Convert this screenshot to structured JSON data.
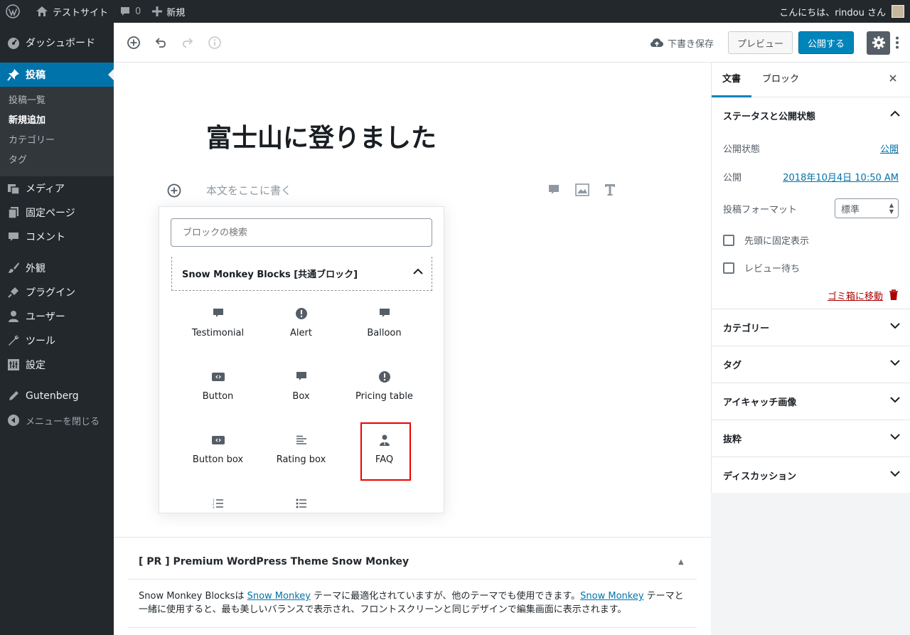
{
  "adminbar": {
    "site_name": "テストサイト",
    "comments_count": "0",
    "new_label": "新規",
    "greeting": "こんにちは、rindou さん"
  },
  "sidebar": {
    "dashboard": "ダッシュボード",
    "posts": "投稿",
    "posts_sub": [
      "投稿一覧",
      "新規追加",
      "カテゴリー",
      "タグ"
    ],
    "media": "メディア",
    "pages": "固定ページ",
    "comments": "コメント",
    "appearance": "外観",
    "plugins": "プラグイン",
    "users": "ユーザー",
    "tools": "ツール",
    "settings": "設定",
    "gutenberg": "Gutenberg",
    "collapse": "メニューを閉じる"
  },
  "toolbar": {
    "save_draft": "下書き保存",
    "preview": "プレビュー",
    "publish": "公開する"
  },
  "post": {
    "title": "富士山に登りました",
    "body_placeholder": "本文をここに書く"
  },
  "inserter": {
    "search_placeholder": "ブロックの検索",
    "panel_title": "Snow Monkey Blocks [共通ブロック]",
    "blocks": [
      {
        "label": "Testimonial",
        "icon": "comment-icon"
      },
      {
        "label": "Alert",
        "icon": "alert-icon"
      },
      {
        "label": "Balloon",
        "icon": "comment-icon"
      },
      {
        "label": "Button",
        "icon": "button-icon"
      },
      {
        "label": "Box",
        "icon": "comment-icon"
      },
      {
        "label": "Pricing table",
        "icon": "alert-icon"
      },
      {
        "label": "Button box",
        "icon": "button-icon"
      },
      {
        "label": "Rating box",
        "icon": "align-left-icon"
      },
      {
        "label": "FAQ",
        "icon": "person-icon"
      }
    ],
    "partial_icons": [
      "ordered-list-icon",
      "list-icon"
    ],
    "highlight_color": "#e00000"
  },
  "pr": {
    "title": "[ PR ] Premium WordPress Theme Snow Monkey",
    "text_1": "Snow Monkey Blocksは ",
    "link_1": "Snow Monkey",
    "text_2": " テーマに最適化されていますが、他のテーマでも使用できます。",
    "link_2": "Snow Monkey",
    "text_3": " テーマと一緒に使用すると、最も美しいバランスで表示され、フロントスクリーンと同じデザインで編集画面に表示されます。"
  },
  "settings": {
    "tab_document": "文書",
    "tab_block": "ブロック",
    "status_section": "ステータスと公開状態",
    "visibility_label": "公開状態",
    "visibility_value": "公開",
    "publish_label": "公開",
    "publish_value": "2018年10月4日 10:50 AM",
    "format_label": "投稿フォーマット",
    "format_value": "標準",
    "sticky_label": "先頭に固定表示",
    "pending_label": "レビュー待ち",
    "trash_label": "ゴミ箱に移動",
    "sections": [
      "カテゴリー",
      "タグ",
      "アイキャッチ画像",
      "抜粋",
      "ディスカッション"
    ]
  },
  "colors": {
    "admin_dark": "#23282d",
    "accent_blue": "#0085ba",
    "link": "#0073aa",
    "trash": "#aa0000"
  }
}
